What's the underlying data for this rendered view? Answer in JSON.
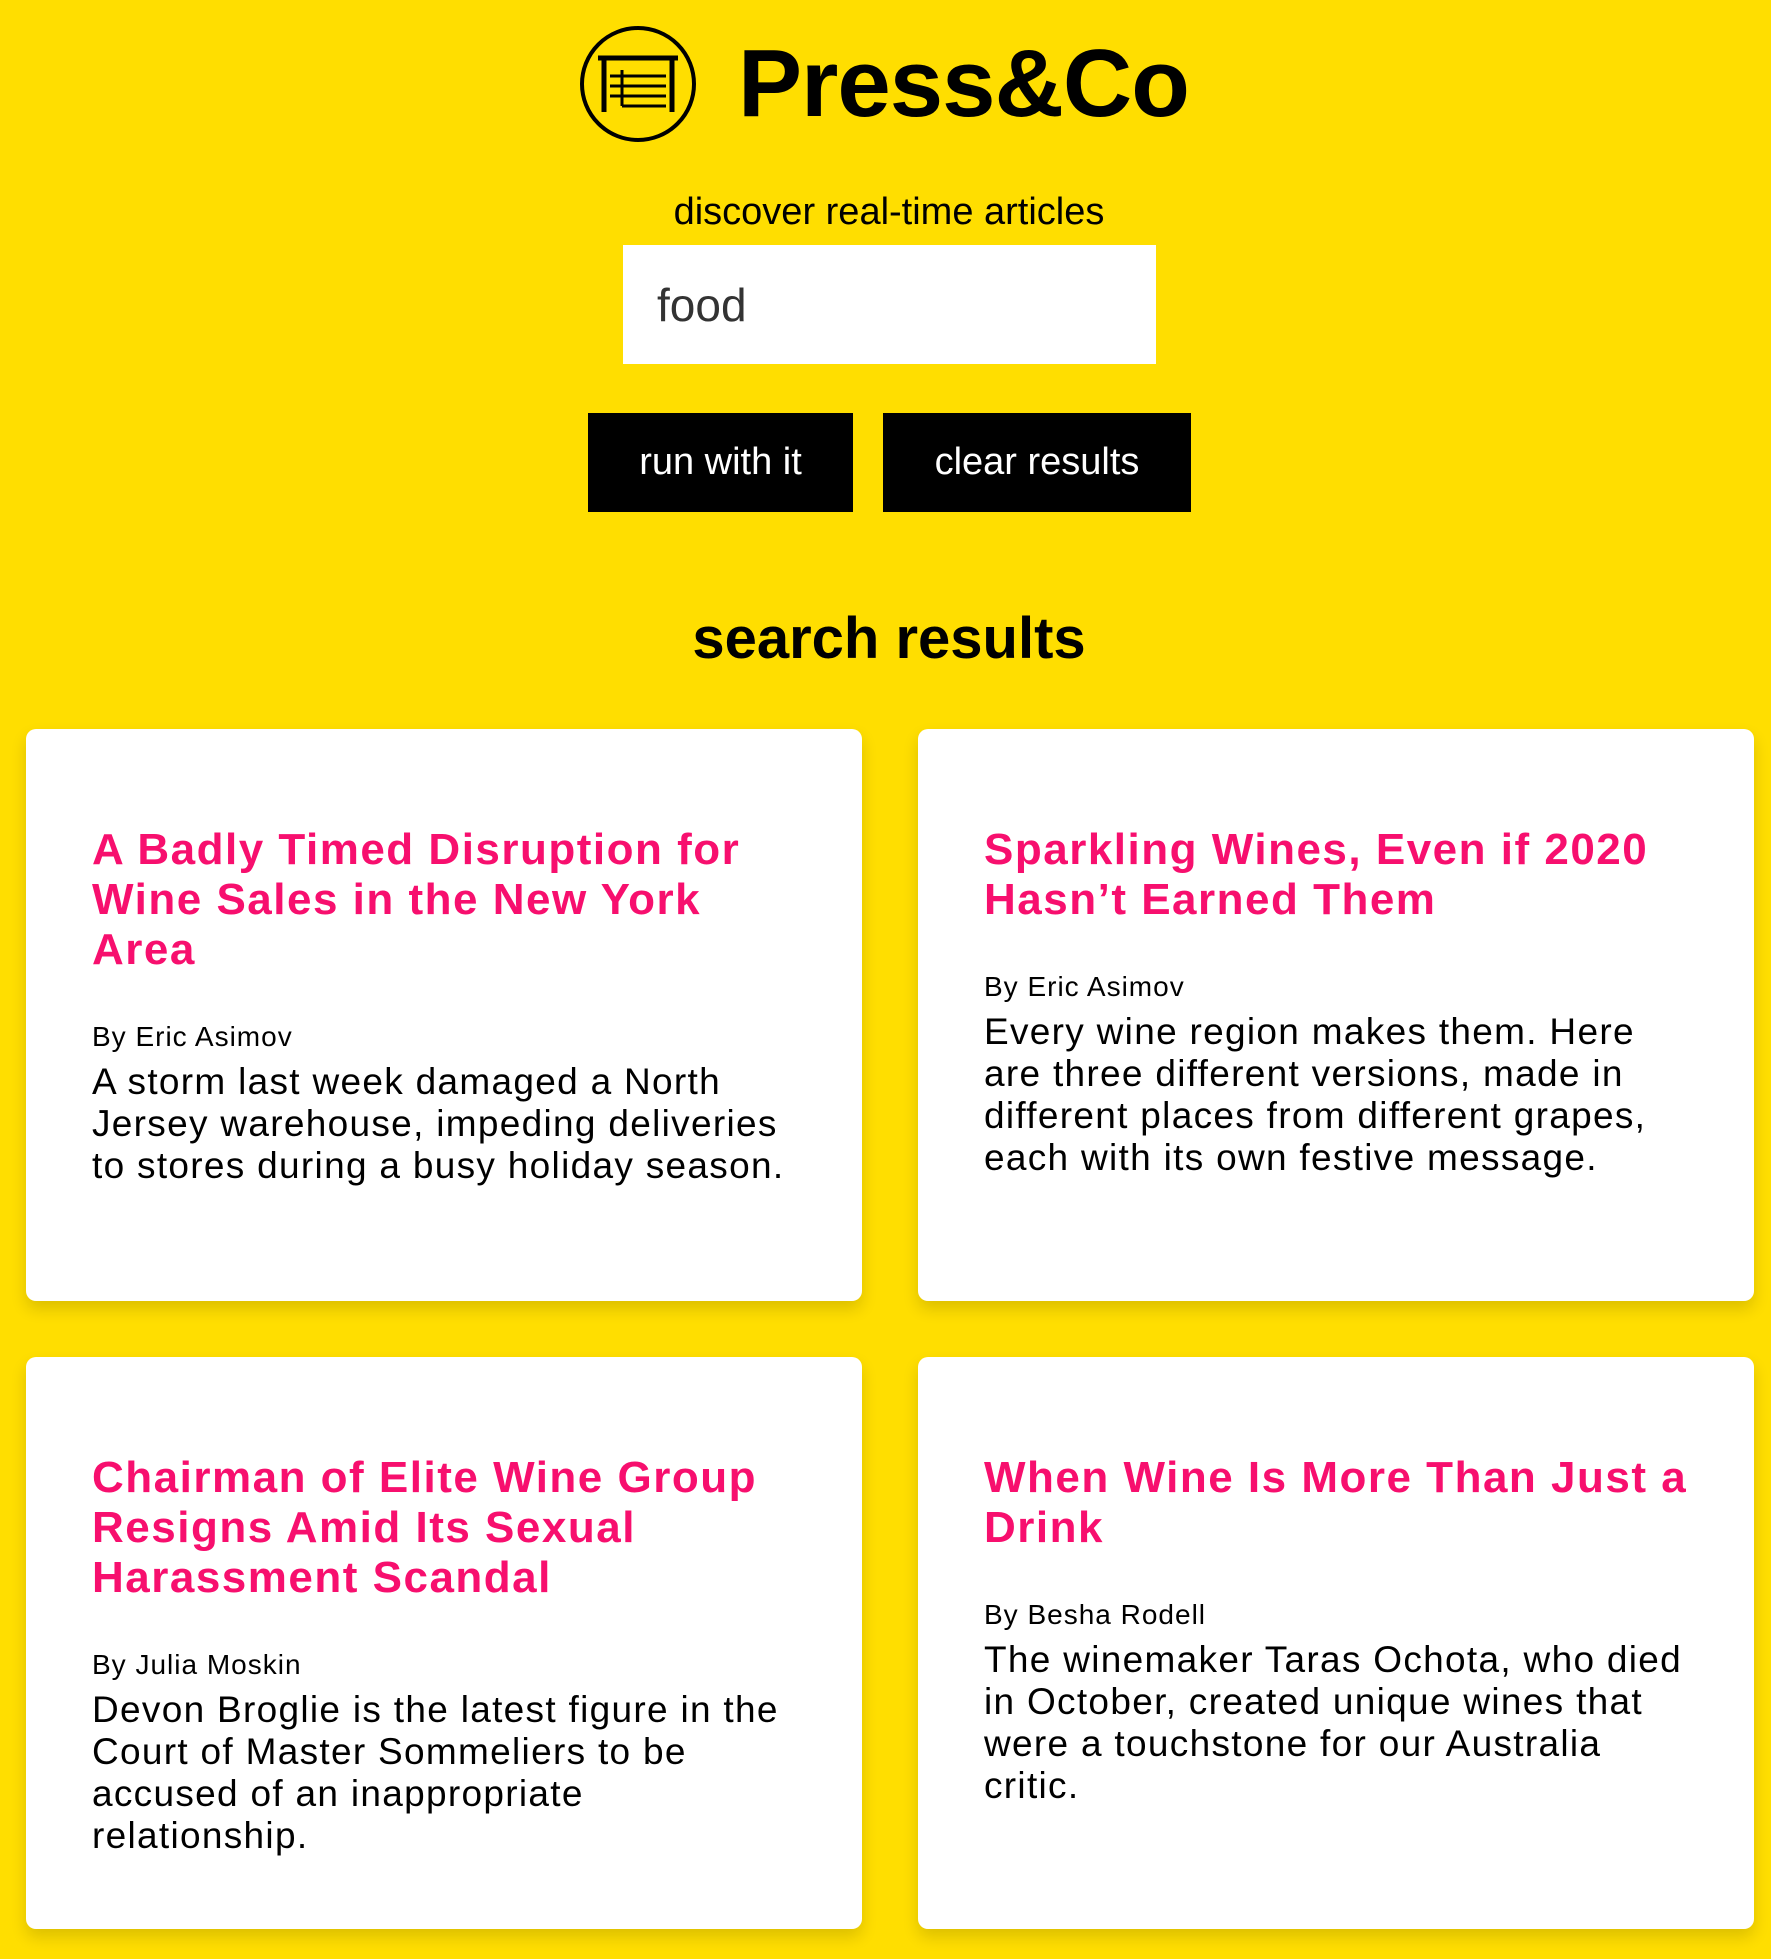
{
  "brand": {
    "name": "Press&Co",
    "logo_icon": "bed-frame-circle-icon"
  },
  "search": {
    "tagline": "discover real-time articles",
    "value": "food",
    "placeholder": ""
  },
  "buttons": {
    "run_label": "run with it",
    "clear_label": "clear results"
  },
  "results": {
    "heading": "search results",
    "articles": [
      {
        "title": "A Badly Timed Disruption for Wine Sales in the New York Area",
        "byline": "By Eric Asimov",
        "summary": "A storm last week damaged a North Jersey warehouse, impeding deliveries to stores during a busy holiday season."
      },
      {
        "title": "Sparkling Wines, Even if 2020 Hasn’t Earned Them",
        "byline": "By Eric Asimov",
        "summary": "Every wine region makes them. Here are three different versions, made in different places from different grapes, each with its own festive message."
      },
      {
        "title": "Chairman of Elite Wine Group Resigns Amid Its Sexual Harassment Scandal",
        "byline": "By Julia Moskin",
        "summary": "Devon Broglie is the latest figure in the Court of Master Sommeliers to be accused of an inappropriate relationship."
      },
      {
        "title": "When Wine Is More Than Just a Drink",
        "byline": "By Besha Rodell",
        "summary": "The winemaker Taras Ochota, who died in October, created unique wines that were a touchstone for our Australia critic."
      }
    ]
  },
  "colors": {
    "background": "#FFDE00",
    "accent": "#F70F6E",
    "button_bg": "#000000",
    "card_bg": "#FFFFFF"
  }
}
